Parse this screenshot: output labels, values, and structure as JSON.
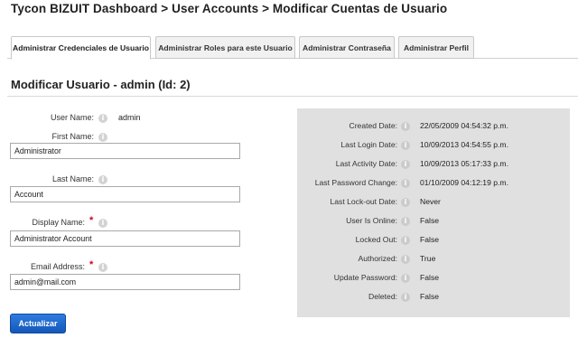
{
  "header": {
    "breadcrumb": "Tycon BIZUIT Dashboard > User Accounts > Modificar Cuentas de Usuario"
  },
  "tabs": [
    {
      "label": "Administrar Credenciales de Usuario",
      "active": true
    },
    {
      "label": "Administrar Roles para este Usuario",
      "active": false
    },
    {
      "label": "Administrar Contraseña",
      "active": false
    },
    {
      "label": "Administrar Perfil",
      "active": false
    }
  ],
  "section": {
    "title": "Modificar Usuario - admin (Id: 2)"
  },
  "form": {
    "username_label": "User Name:",
    "username_value": "admin",
    "firstname_label": "First Name:",
    "firstname_value": "Administrator",
    "lastname_label": "Last Name:",
    "lastname_value": "Account",
    "displayname_label": "Display Name:",
    "displayname_value": "Administrator Account",
    "email_label": "Email Address:",
    "email_value": "admin@mail.com",
    "required_mark": "*",
    "submit_label": "Actualizar"
  },
  "info_glyph": "i",
  "details": [
    {
      "label": "Created Date:",
      "value": "22/05/2009 04:54:32 p.m."
    },
    {
      "label": "Last Login Date:",
      "value": "10/09/2013 04:54:55 p.m."
    },
    {
      "label": "Last Activity Date:",
      "value": "10/09/2013 05:17:33 p.m."
    },
    {
      "label": "Last Password Change:",
      "value": "01/10/2009 04:12:19 p.m."
    },
    {
      "label": "Last Lock-out Date:",
      "value": "Never"
    },
    {
      "label": "User Is Online:",
      "value": "False"
    },
    {
      "label": "Locked Out:",
      "value": "False"
    },
    {
      "label": "Authorized:",
      "value": "True"
    },
    {
      "label": "Update Password:",
      "value": "False"
    },
    {
      "label": "Deleted:",
      "value": "False"
    }
  ],
  "colors": {
    "button": "#1a64c8",
    "panel": "#e0e0e0",
    "required": "#d0021b"
  }
}
